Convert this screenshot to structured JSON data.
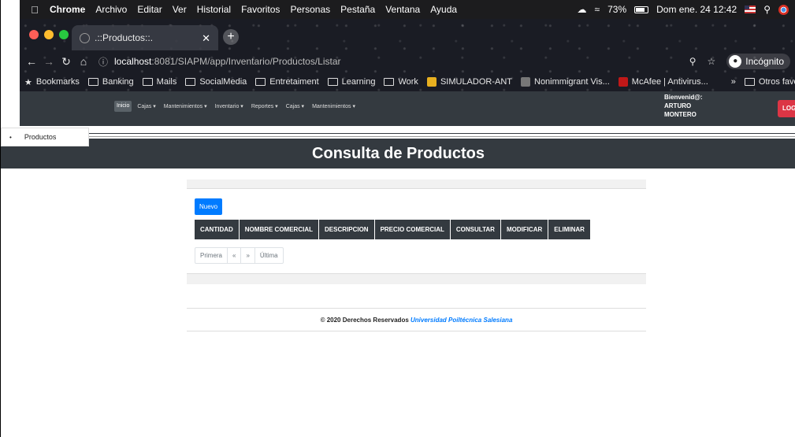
{
  "macbar": {
    "app": "Chrome",
    "menus": [
      "Archivo",
      "Editar",
      "Ver",
      "Historial",
      "Favoritos",
      "Personas",
      "Pestaña",
      "Ventana",
      "Ayuda"
    ],
    "battery": "73%",
    "datetime": "Dom ene. 24  12:42"
  },
  "tab": {
    "title": ".::Productos::."
  },
  "address": {
    "host": "localhost",
    "path": ":8081/SIAPM/app/Inventario/Productos/Listar"
  },
  "incognito": "Incógnito",
  "bookmarks": {
    "items": [
      "Bookmarks",
      "Banking",
      "Mails",
      "SocialMedia",
      "Entretaiment",
      "Learning",
      "Work",
      "SIMULADOR-ANT",
      "Nonimmigrant Vis...",
      "McAfee | Antivirus..."
    ],
    "more": "»",
    "other": "Otros favorit"
  },
  "nav": {
    "items": [
      "Inicio",
      "Cajas",
      "Mantenimientos",
      "Inventario",
      "Reportes",
      "Cajas",
      "Mantenimientos"
    ],
    "welcome_line1": "Bienvenid@:",
    "welcome_line2": "ARTURO",
    "welcome_line3": "MONTERO",
    "logout": "LOG"
  },
  "sidemenu": {
    "item": "Productos"
  },
  "page_title": "Consulta de Productos",
  "new_button": "Nuevo",
  "table": {
    "headers": [
      "CANTIDAD",
      "NOMBRE COMERCIAL",
      "DESCRIPCION",
      "PRECIO COMERCIAL",
      "CONSULTAR",
      "MODIFICAR",
      "ELIMINAR"
    ]
  },
  "pager": {
    "first": "Primera",
    "prev": "«",
    "next": "»",
    "last": "Última"
  },
  "footer": {
    "text": "© 2020 Derechos Reservados ",
    "org": "Universidad Poiltécnica Salesiana"
  }
}
